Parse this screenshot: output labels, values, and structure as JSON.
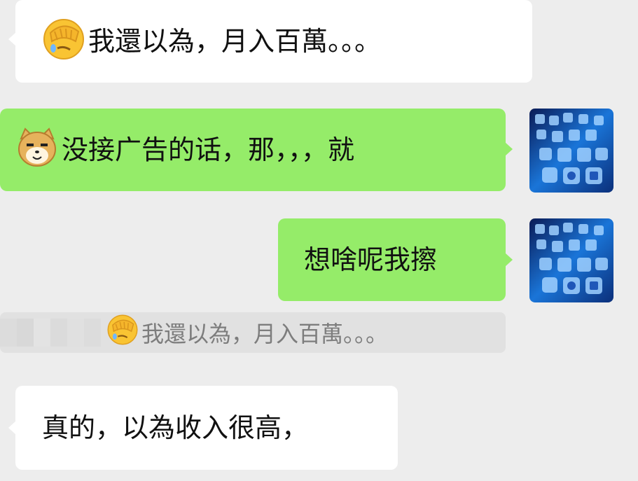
{
  "messages": [
    {
      "side": "left",
      "emoji": "face-palm-emoji",
      "text": "我還以為，月入百萬。。。"
    },
    {
      "side": "right",
      "emoji": "doge-emoji",
      "text": "没接广告的话，那，，，就"
    },
    {
      "side": "right",
      "emoji": "",
      "text": "想啥呢我擦"
    },
    {
      "side": "left",
      "emoji": "",
      "text": "真的，以為收入很高，"
    }
  ],
  "quote": {
    "emoji": "face-palm-emoji",
    "text": "我還以為，月入百萬。。。"
  },
  "colors": {
    "background": "#ededed",
    "incoming_bubble": "#ffffff",
    "outgoing_bubble": "#95ec69",
    "quote_background": "#e1e1e1",
    "quote_text": "#7d7d7d"
  }
}
